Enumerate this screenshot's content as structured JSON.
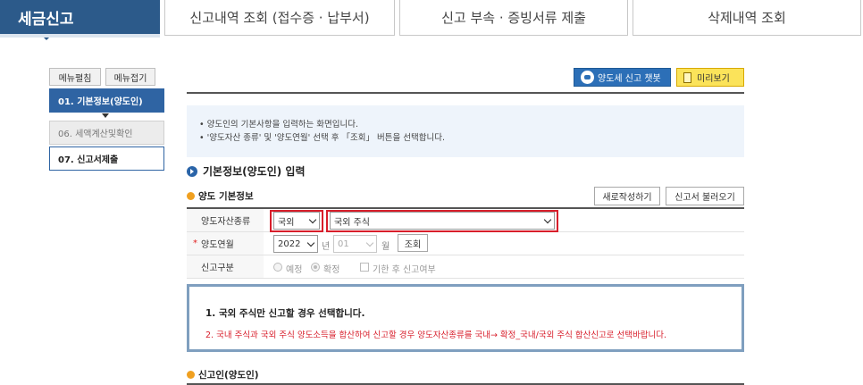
{
  "top_tabs": {
    "active": "세금신고",
    "items": [
      "신고내역 조회 (접수증 · 납부서)",
      "신고 부속 · 증빙서류 제출",
      "삭제내역 조회"
    ]
  },
  "left_menu": {
    "expand_label": "메뉴펼침",
    "collapse_label": "메뉴접기",
    "steps": [
      "01. 기본정보(양도인)",
      "06. 세액계산및확인",
      "07. 신고서제출"
    ]
  },
  "toolbar": {
    "chatbot_label": "양도세 신고 챗봇",
    "preview_label": "미리보기"
  },
  "info": {
    "lines": [
      "• 양도인의 기본사항을 입력하는 화면입니다.",
      "• '양도자산 종류' 및 '양도연월' 선택 후 「조회」 버튼을 선택합니다."
    ]
  },
  "section": {
    "title": "기본정보(양도인) 입력",
    "sub_title": "양도 기본정보",
    "new_button": "새로작성하기",
    "load_button": "신고서 불러오기"
  },
  "form": {
    "asset_type_label": "양도자산종류",
    "asset_type_value": "국외",
    "asset_detail_value": "국외 주식",
    "year_month_label": "양도연월",
    "required_mark": "*",
    "year_value": "2022",
    "year_unit": "년",
    "month_value": "01",
    "month_unit": "월",
    "query_button": "조회",
    "report_type_label": "신고구분",
    "option_plan": "예정",
    "option_final": "확정",
    "late_label": "기한 후 신고여부"
  },
  "notice": {
    "line1": "1. 국외 주식만 신고할 경우 선택합니다.",
    "line2": "2. 국내 주식과 국외 주식 양도소득을 합산하여 신고할 경우 양도자산종류를 국내→ 확정_국내/국외 주식 합산신고로 선택바랍니다."
  },
  "reporter": {
    "title": "신고인(양도인)"
  },
  "colors": {
    "primary": "#2c5a8a",
    "step_active": "#2f64a3",
    "highlight_red": "#d81e2b",
    "preview_yellow": "#fbe35a",
    "bullet_orange": "#f0a020"
  }
}
